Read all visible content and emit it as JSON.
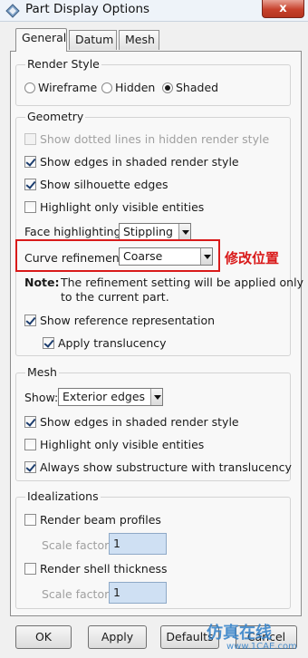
{
  "window": {
    "title": "Part Display Options",
    "close_label": "x"
  },
  "tabs": [
    "General",
    "Datum",
    "Mesh"
  ],
  "render_style": {
    "label": "Render Style",
    "options": [
      {
        "label": "Wireframe",
        "selected": false
      },
      {
        "label": "Hidden",
        "selected": false
      },
      {
        "label": "Shaded",
        "selected": true
      }
    ]
  },
  "geometry": {
    "label": "Geometry",
    "dotted_lines": {
      "label": "Show dotted lines in hidden render style",
      "checked": false,
      "enabled": false
    },
    "show_edges": {
      "label": "Show edges in shaded render style",
      "checked": true
    },
    "silhouette": {
      "label": "Show silhouette edges",
      "checked": true
    },
    "highlight_visible": {
      "label": "Highlight only visible entities",
      "checked": false
    },
    "face_highlighting": {
      "label": "Face highlighting:",
      "value": "Stippling"
    },
    "curve_refinement": {
      "label": "Curve refinement:",
      "value": "Coarse"
    },
    "note_label": "Note:",
    "note_line1": "The refinement setting will be applied only",
    "note_line2": "to the current part.",
    "show_reference": {
      "label": "Show reference representation",
      "checked": true
    },
    "apply_translucency": {
      "label": "Apply translucency",
      "checked": true
    }
  },
  "annotation": "修改位置",
  "mesh": {
    "label": "Mesh",
    "show_label": "Show:",
    "show_value": "Exterior edges",
    "show_edges": {
      "label": "Show edges in shaded render style",
      "checked": true
    },
    "highlight_visible": {
      "label": "Highlight only visible entities",
      "checked": false
    },
    "substructure": {
      "label": "Always show substructure with translucency",
      "checked": true
    }
  },
  "idealizations": {
    "label": "Idealizations",
    "beam": {
      "label": "Render beam profiles",
      "checked": false,
      "scale_label": "Scale factor:",
      "scale_value": "1"
    },
    "shell": {
      "label": "Render shell thickness",
      "checked": false,
      "scale_label": "Scale factor:",
      "scale_value": "1"
    }
  },
  "buttons": {
    "ok": "OK",
    "apply": "Apply",
    "defaults": "Defaults",
    "cancel": "Cancel"
  },
  "watermark": {
    "text": "仿真在线",
    "url": "www.1CAE.com"
  },
  "colors": {
    "annotation": "#d91a1a",
    "close_button": "#c7412c",
    "watermark": "#2f7fc8"
  }
}
